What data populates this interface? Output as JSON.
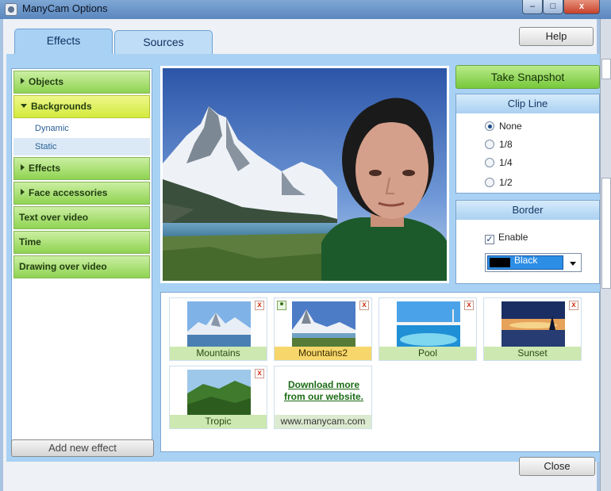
{
  "window": {
    "title": "ManyCam Options",
    "minimize_glyph": "–",
    "maximize_glyph": "□",
    "close_glyph": "x"
  },
  "tabs": [
    {
      "label": "Effects",
      "active": true
    },
    {
      "label": "Sources",
      "active": false
    }
  ],
  "help_label": "Help",
  "menu": {
    "items": [
      {
        "label": "Objects"
      },
      {
        "label": "Backgrounds"
      },
      {
        "label": "Effects"
      },
      {
        "label": "Face accessories"
      },
      {
        "label": "Text over video"
      },
      {
        "label": "Time"
      },
      {
        "label": "Drawing over video"
      }
    ],
    "subitems": [
      {
        "label": "Dynamic"
      },
      {
        "label": "Static"
      }
    ],
    "add_label": "Add new effect"
  },
  "snapshot_label": "Take Snapshot",
  "clip_line": {
    "title": "Clip Line",
    "options": [
      "None",
      "1/8",
      "1/4",
      "1/2"
    ],
    "selected": "None"
  },
  "border": {
    "title": "Border",
    "enable_label": "Enable",
    "enable_checked": true,
    "check_glyph": "✓",
    "color_label": "Black",
    "color_hex": "#000000"
  },
  "gallery": {
    "items": [
      {
        "caption": "Mountains"
      },
      {
        "caption": "Mountains2",
        "selected": true
      },
      {
        "caption": "Pool"
      },
      {
        "caption": "Sunset"
      },
      {
        "caption": "Tropic"
      }
    ],
    "download_text": "Download more from our website.",
    "download_caption": "www.manycam.com",
    "delete_glyph": "x"
  },
  "close_label": "Close",
  "colors": {
    "tab_blue": "#a8d1f4",
    "menu_green": "#8fd351",
    "menu_selected": "#d3ea3d",
    "accent_blue": "#2d8ee6"
  }
}
